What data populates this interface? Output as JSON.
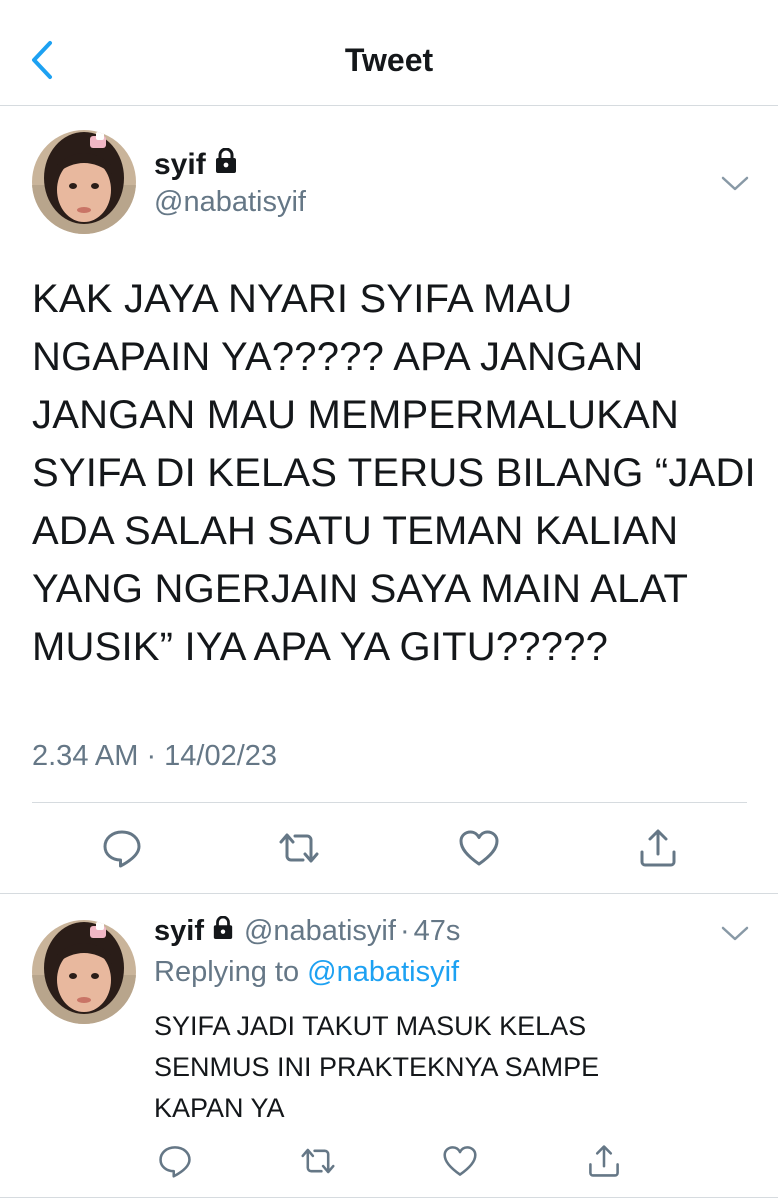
{
  "header": {
    "title": "Tweet",
    "back_icon": "chevron-left-icon",
    "accent_color": "#1da1f2"
  },
  "tweet": {
    "author": {
      "display_name": "syif",
      "handle": "@nabatisyif",
      "protected_icon": "lock-icon"
    },
    "text_lines": [
      "KAK JAYA NYARI SYIFA MAU",
      "NGAPAIN YA????? APA JANGAN",
      "JANGAN MAU MEMPERMALUKAN",
      "SYIFA DI KELAS TERUS BILANG “JADI",
      "ADA SALAH SATU TEMAN KALIAN",
      "YANG NGERJAIN SAYA MAIN ALAT",
      "MUSIK” IYA APA YA GITU?????"
    ],
    "timestamp": "2.34 AM · 14/02/23",
    "actions": [
      "reply-icon",
      "retweet-icon",
      "like-icon",
      "share-icon"
    ]
  },
  "reply": {
    "author": {
      "display_name": "syif",
      "handle": "@nabatisyif",
      "protected_icon": "lock-icon"
    },
    "separator": "·",
    "age": "47s",
    "replying_prefix": "Replying to ",
    "replying_handle": "@nabatisyif",
    "text_lines": [
      "SYIFA JADI TAKUT MASUK KELAS",
      "SENMUS INI PRAKTEKNYA SAMPE",
      "KAPAN YA"
    ],
    "actions": [
      "reply-icon",
      "retweet-icon",
      "like-icon",
      "share-icon"
    ]
  },
  "colors": {
    "text_primary": "#14171a",
    "text_secondary": "#657786",
    "link": "#1da1f2",
    "divider": "#d6dbdf"
  }
}
